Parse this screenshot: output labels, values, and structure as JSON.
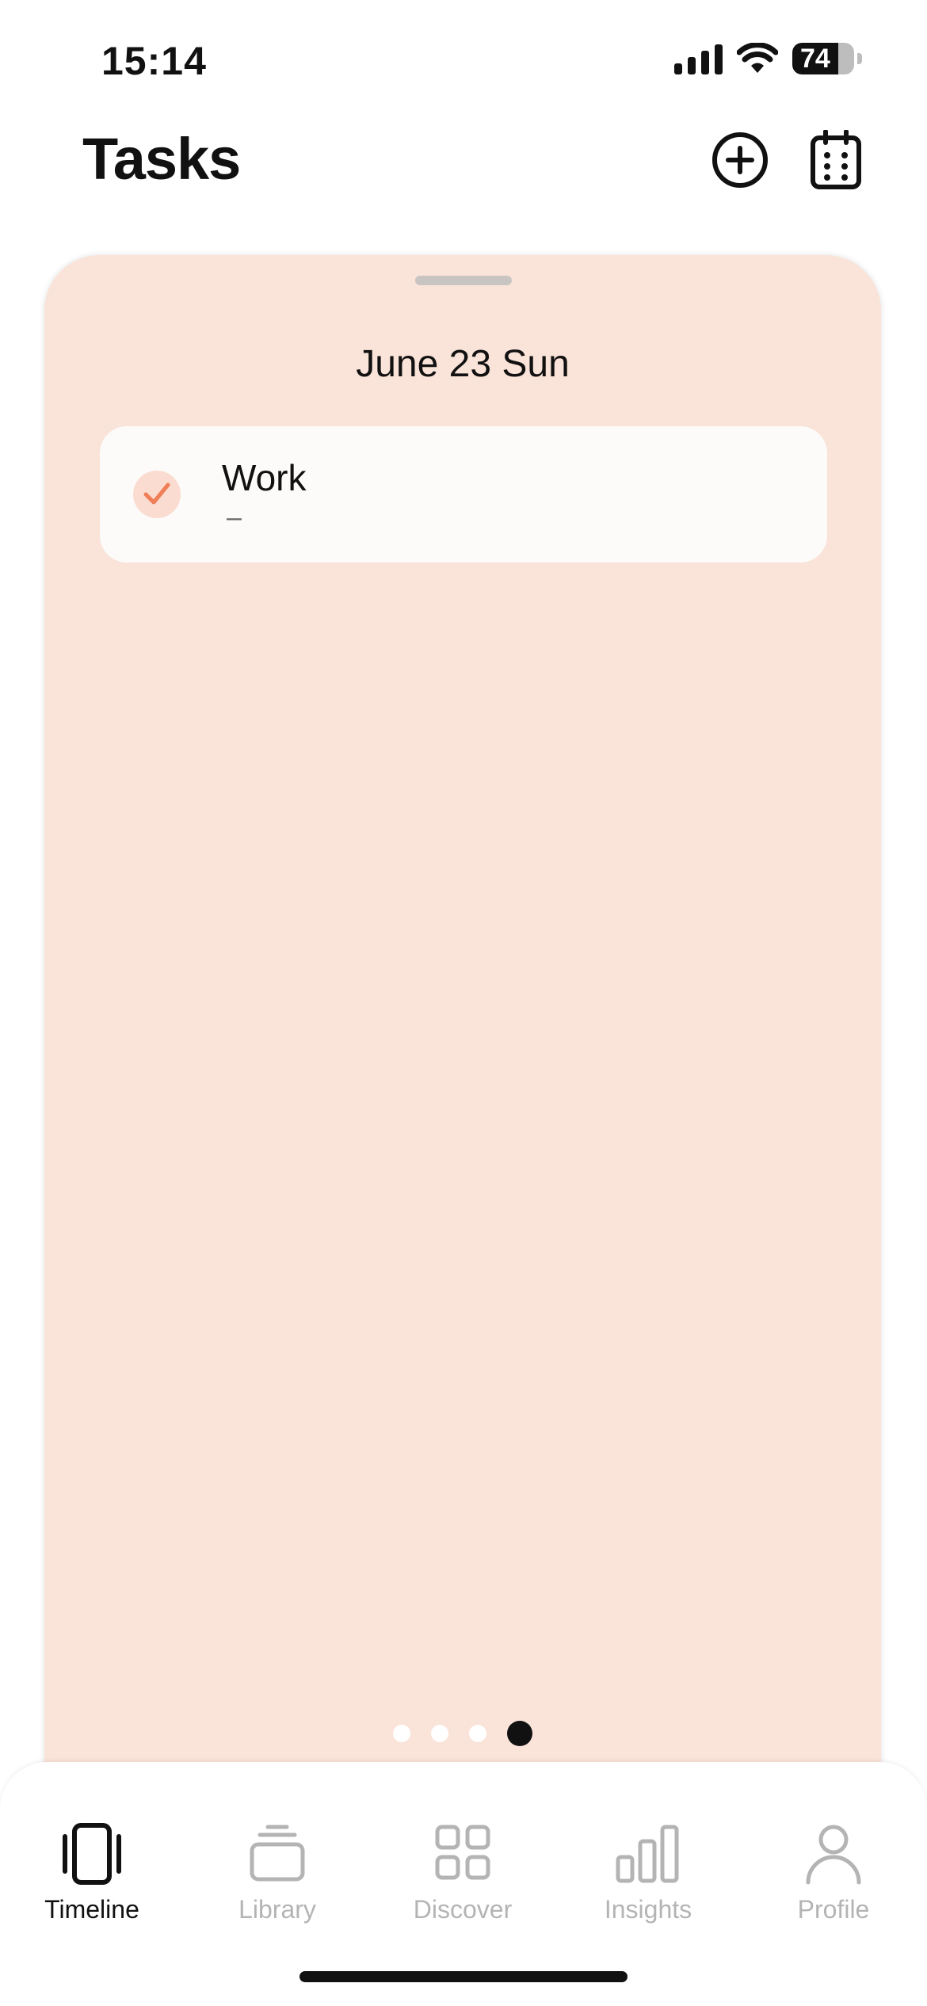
{
  "status": {
    "time": "15:14",
    "battery": "74"
  },
  "header": {
    "title": "Tasks"
  },
  "card": {
    "date": "June 23 Sun",
    "task": {
      "title": "Work",
      "subtitle": "–"
    },
    "pages": 4,
    "active_page": 4
  },
  "tabs": [
    {
      "label": "Timeline",
      "icon": "timeline-icon",
      "active": true
    },
    {
      "label": "Library",
      "icon": "library-icon",
      "active": false
    },
    {
      "label": "Discover",
      "icon": "discover-icon",
      "active": false
    },
    {
      "label": "Insights",
      "icon": "insights-icon",
      "active": false
    },
    {
      "label": "Profile",
      "icon": "profile-icon",
      "active": false
    }
  ],
  "colors": {
    "card_bg": "#fae3d8",
    "accent": "#f07e56",
    "inactive": "#b4b4b4"
  }
}
